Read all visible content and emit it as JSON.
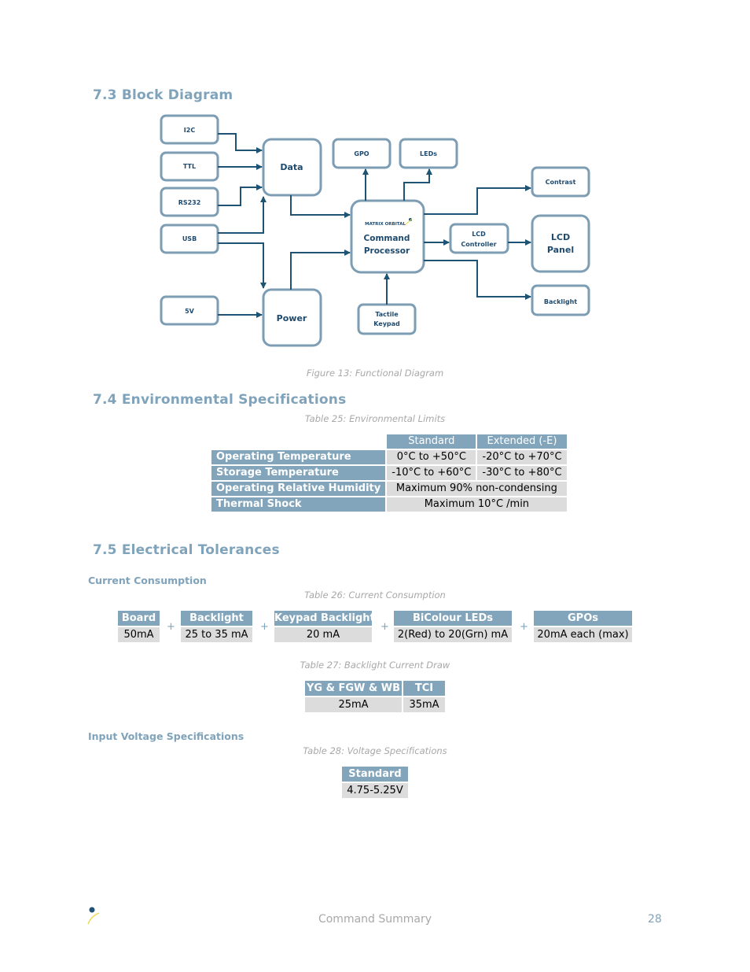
{
  "sections": {
    "block_diagram": {
      "title": "7.3 Block Diagram",
      "figure_caption": "Figure 13: Functional Diagram"
    },
    "environmental": {
      "title": "7.4 Environmental Specifications",
      "table_caption": "Table 25: Environmental Limits"
    },
    "electrical": {
      "title": "7.5 Electrical Tolerances",
      "current_consumption_heading": "Current Consumption",
      "current_table_caption": "Table 26: Current Consumption",
      "backlight_table_caption": "Table 27: Backlight Current Draw",
      "input_voltage_heading": "Input Voltage Specifications",
      "voltage_table_caption": "Table 28: Voltage Specifications"
    }
  },
  "diagram": {
    "blocks": {
      "i2c": "I2C",
      "ttl": "TTL",
      "rs232": "RS232",
      "usb": "USB",
      "v5": "5V",
      "data": "Data",
      "power": "Power",
      "gpo": "GPO",
      "leds": "LEDs",
      "brand": "MATRIX ORBITAL",
      "cmd1": "Command",
      "cmd2": "Processor",
      "tactile1": "Tactile",
      "tactile2": "Keypad",
      "lcdc1": "LCD",
      "lcdc2": "Controller",
      "contrast": "Contrast",
      "panel1": "LCD",
      "panel2": "Panel",
      "backlight": "Backlight"
    }
  },
  "env_table": {
    "headers": [
      "Standard",
      "Extended (-E)"
    ],
    "rows": [
      {
        "label": "Operating Temperature",
        "standard": "0°C to +50°C",
        "extended": "-20°C to +70°C"
      },
      {
        "label": "Storage Temperature",
        "standard": "-10°C to +60°C",
        "extended": "-30°C to +80°C"
      },
      {
        "label": "Operating Relative Humidity",
        "merged": "Maximum 90% non-condensing"
      },
      {
        "label": "Thermal Shock",
        "merged": "Maximum 10°C /min"
      }
    ]
  },
  "current_table": {
    "items": [
      {
        "header": "Board",
        "value": "50mA"
      },
      {
        "header": "Backlight",
        "value": "25 to 35 mA"
      },
      {
        "header": "Keypad Backlight",
        "value": "20 mA"
      },
      {
        "header": "BiColour LEDs",
        "value": "2(Red) to 20(Grn) mA"
      },
      {
        "header": "GPOs",
        "value": "20mA each (max)"
      }
    ],
    "operator": "+"
  },
  "backlight_table": {
    "headers": [
      "YG & FGW & WB",
      "TCI"
    ],
    "values": [
      "25mA",
      "35mA"
    ]
  },
  "voltage_table": {
    "header": "Standard",
    "value": "4.75-5.25V"
  },
  "footer": {
    "title": "Command Summary",
    "page": "28",
    "logo_icon": "matrix-orbital-logo-icon"
  },
  "colors": {
    "accent": "#7fa3bb",
    "table_header": "#82a5bb",
    "table_cell": "#dcdcdc",
    "diagram_border": "#7c9db3",
    "diagram_line": "#1e5373",
    "caption": "#a8a8a8"
  }
}
